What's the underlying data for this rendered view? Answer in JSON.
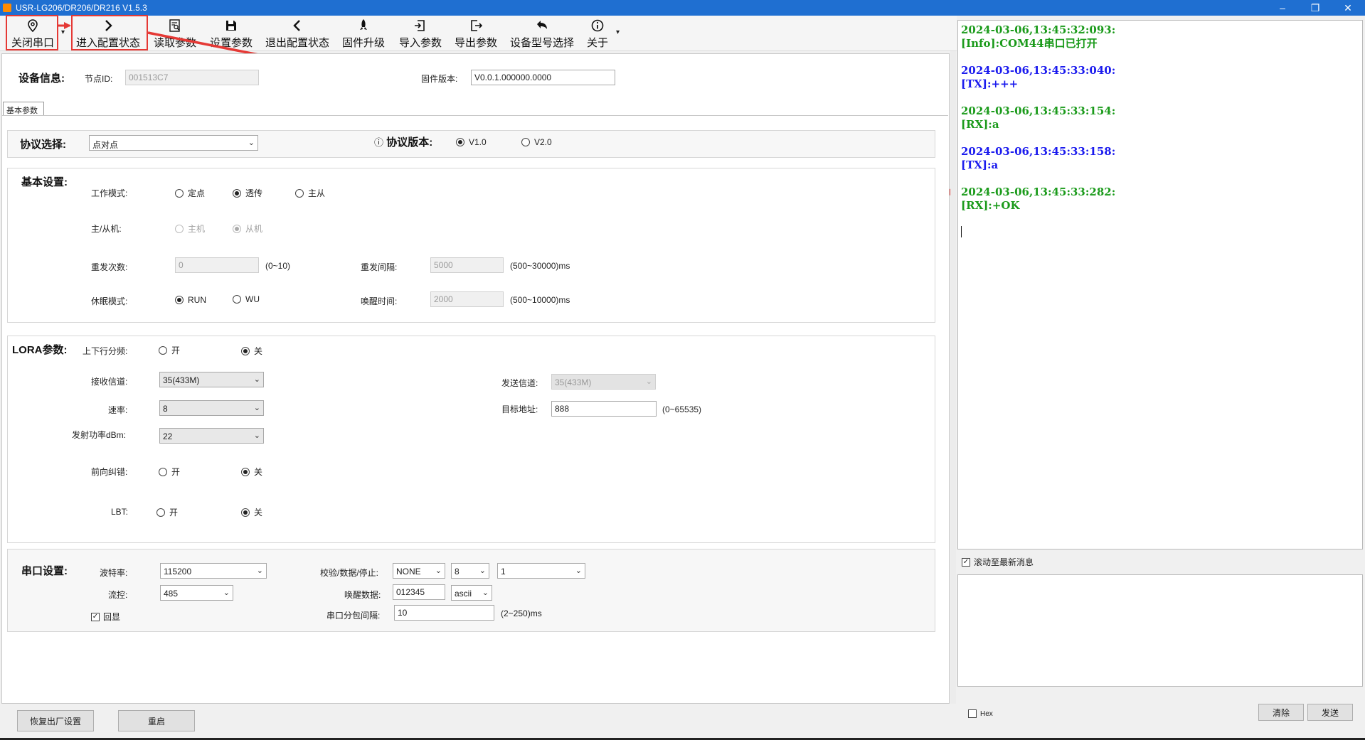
{
  "window": {
    "title": "USR-LG206/DR206/DR216 V1.5.3",
    "controls": [
      "minimize",
      "restore",
      "close"
    ]
  },
  "toolbar": {
    "items": [
      {
        "label": "关闭串口",
        "icon": "location-pin-icon"
      },
      {
        "label": "进入配置状态",
        "icon": "chevron-right-icon"
      },
      {
        "label": "读取参数",
        "icon": "read-document-icon"
      },
      {
        "label": "设置参数",
        "icon": "save-icon"
      },
      {
        "label": "退出配置状态",
        "icon": "chevron-left-icon"
      },
      {
        "label": "固件升级",
        "icon": "rocket-icon"
      },
      {
        "label": "导入参数",
        "icon": "import-icon"
      },
      {
        "label": "导出参数",
        "icon": "export-icon"
      },
      {
        "label": "设备型号选择",
        "icon": "undo-arrow-icon"
      },
      {
        "label": "关于",
        "icon": "info-icon"
      }
    ]
  },
  "device_info": {
    "title": "设备信息:",
    "node_id_label": "节点ID:",
    "node_id": "001513C7",
    "firmware_label": "固件版本:",
    "firmware": "V0.0.1.000000.0000"
  },
  "tab": {
    "label": "基本参数"
  },
  "protocol": {
    "label": "协议选择:",
    "value": "点对点",
    "version_label": "协议版本:",
    "options": [
      "V1.0",
      "V2.0"
    ],
    "selected": "V1.0"
  },
  "basic": {
    "title": "基本设置:",
    "work_mode_label": "工作模式:",
    "work_modes": [
      "定点",
      "透传",
      "主从"
    ],
    "work_mode_selected": "透传",
    "master_slave_label": "主/从机:",
    "master_slave_opts": [
      "主机",
      "从机"
    ],
    "retry_count_label": "重发次数:",
    "retry_count": "0",
    "retry_count_range": "(0~10)",
    "retry_interval_label": "重发间隔:",
    "retry_interval": "5000",
    "retry_interval_range": "(500~30000)ms",
    "sleep_mode_label": "休眠模式:",
    "sleep_modes": [
      "RUN",
      "WU"
    ],
    "wake_time_label": "唤醒时间:",
    "wake_time": "2000",
    "wake_time_range": "(500~10000)ms"
  },
  "lora": {
    "title": "LORA参数:",
    "updown_label": "上下行分频:",
    "on": "开",
    "off": "关",
    "rx_channel_label": "接收信道:",
    "rx_channel": "35(433M)",
    "tx_channel_label": "发送信道:",
    "tx_channel": "35(433M)",
    "rate_label": "速率:",
    "rate": "8",
    "target_label": "目标地址:",
    "target": "888",
    "target_range": "(0~65535)",
    "power_label": "发射功率dBm:",
    "power": "22",
    "fec_label": "前向纠错:",
    "lbt_label": "LBT:"
  },
  "serial": {
    "title": "串口设置:",
    "baud_label": "波特率:",
    "baud": "115200",
    "parity_label": "校验/数据/停止:",
    "parity": "NONE",
    "databits": "8",
    "stopbits": "1",
    "flow_label": "流控:",
    "flow": "485",
    "wake_data_label": "唤醒数据:",
    "wake_data": "012345",
    "wake_data_format": "ascii",
    "echo_label": "回显",
    "packet_interval_label": "串口分包间隔:",
    "packet_interval": "10",
    "packet_interval_range": "(2~250)ms"
  },
  "bottom": {
    "factory_reset": "恢复出厂设置",
    "restart": "重启"
  },
  "log": {
    "entries": [
      {
        "time": "2024-03-06,13:45:32:093:",
        "msg": "[Info]:COM44串口已打开",
        "color": "green"
      },
      {
        "time": "2024-03-06,13:45:33:040:",
        "msg": "[TX]:+++",
        "color": "blue"
      },
      {
        "time": "2024-03-06,13:45:33:154:",
        "msg": "[RX]:a",
        "color": "green"
      },
      {
        "time": "2024-03-06,13:45:33:158:",
        "msg": "[TX]:a",
        "color": "blue"
      },
      {
        "time": "2024-03-06,13:45:33:282:",
        "msg": "[RX]:+OK",
        "color": "green"
      }
    ],
    "autoscroll_label": "滚动至最新消息",
    "hex_label": "Hex",
    "clear_label": "清除",
    "send_label": "发送"
  },
  "colors": {
    "annotation": "#e53935",
    "log_green": "#1a9a1a",
    "log_blue": "#1a1aee",
    "titlebar": "#1f6fd1"
  }
}
